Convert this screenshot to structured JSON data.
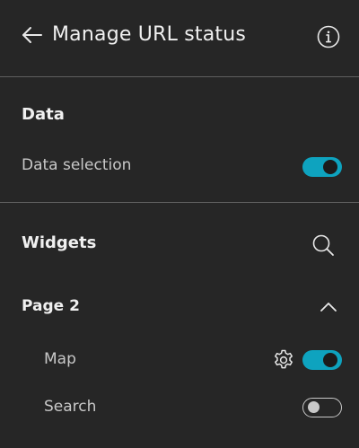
{
  "header": {
    "title": "Manage URL status",
    "back_icon": "arrow-left-icon",
    "info_icon": "info-icon"
  },
  "data_section": {
    "title": "Data",
    "items": [
      {
        "label": "Data selection",
        "enabled": true
      }
    ]
  },
  "widgets_section": {
    "title": "Widgets",
    "search_icon": "search-icon",
    "pages": [
      {
        "label": "Page 2",
        "expanded": true,
        "chevron_icon": "chevron-up-icon",
        "widgets": [
          {
            "label": "Map",
            "enabled": true,
            "has_settings": true
          },
          {
            "label": "Search",
            "enabled": false,
            "has_settings": false
          }
        ]
      }
    ]
  },
  "colors": {
    "background": "#262626",
    "accent": "#0ea3bf",
    "divider": "#5f5f5f",
    "text": "#f0f0f0",
    "muted_text": "#c8c8c8"
  }
}
